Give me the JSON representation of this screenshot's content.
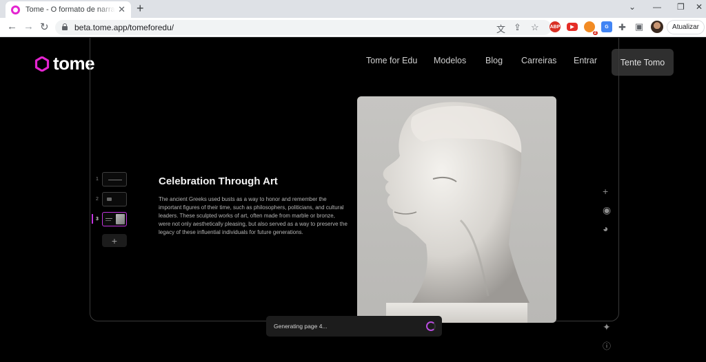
{
  "browser": {
    "tab_title": "Tome - O formato de narrativa baseado em IA",
    "url": "beta.tome.app/tomeforedu/",
    "update_label": "Atualizar",
    "extension_badge": "2",
    "extension_label_abp": "ABP"
  },
  "site": {
    "logo_text": "tome",
    "nav": [
      "Tome for Edu",
      "Modelos",
      "Blog",
      "Carreiras",
      "Entrar"
    ],
    "cta_label": "Tente Tomo"
  },
  "editor": {
    "thumbnails": [
      {
        "number": "1",
        "kind": "title"
      },
      {
        "number": "2",
        "kind": "video"
      },
      {
        "number": "3",
        "kind": "image",
        "active": true
      }
    ],
    "add_page_label": "+",
    "page": {
      "title": "Celebration Through Art",
      "body": "The ancient Greeks used busts as a way to honor and remember the important figures of their time, such as philosophers, politicians, and cultural leaders. These sculpted works of art, often made from marble or bronze, were not only aesthetically pleasing, but also served as a way to preserve the legacy of these influential individuals for future generations."
    },
    "side_icons": [
      "plus-icon",
      "record-icon",
      "palette-icon",
      "sparkle-icon",
      "help-icon"
    ],
    "status_text": "Generating page 4...",
    "accent_color": "#c435e0"
  }
}
